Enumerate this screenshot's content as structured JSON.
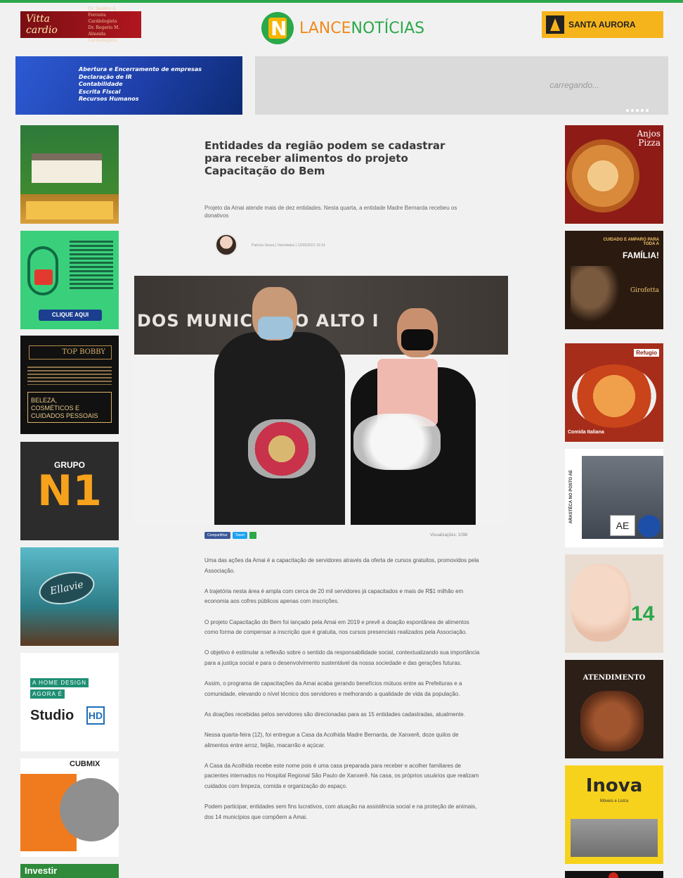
{
  "header": {
    "ad_left_logo": "Vitta cardio",
    "ad_left_doctors": [
      "Dr. Sandro A. Ferreira",
      "Cardiologista",
      "Dr. Rogerio M. Almeida",
      "Cardiologista"
    ],
    "logo_part1": "LANCE",
    "logo_part2": "NOTÍCIAS",
    "ad_right_label": "SANTA AURORA"
  },
  "banner": {
    "left_lines": [
      "Abertura e Encerramento de empresas",
      "Declaração de IR",
      "Contabilidade",
      "Escrita Fiscal",
      "Recursos Humanos"
    ],
    "right_loading": "carregando..."
  },
  "left_ads": {
    "security_cta": "CLIQUE AQUI",
    "beauty_brand": "TOP BOBBY",
    "beauty_lines": [
      "BELEZA,",
      "COSMÉTICOS E",
      "CUIDADOS PESSOAIS"
    ],
    "grupo_label": "GRUPO",
    "grupo_mark": "N1",
    "ellavie": "Ellavie",
    "home_design_1": "A HOME DESIGN",
    "home_design_2": "AGORA É",
    "studio": "Studio",
    "studio_mark": "HD",
    "cubmix": "CUBMIX",
    "investir": "Investir"
  },
  "right_ads": {
    "pizza": "Anjos Pizza",
    "familia_1": "CUIDADO E AMPARO PARA TODA A",
    "familia_2": "FAMÍLIA!",
    "familia_brand": "Girofetta",
    "italian_brand": "Refugio",
    "italian_caption": "Comida Italiana",
    "posto_brand": "AE",
    "posto_side": "ARASTÉCA NO POSTO AE",
    "baby_number": "14",
    "atendimento": "ATENDIMENTO",
    "inova": "Inova",
    "inova_sub": "Móveis e Listra"
  },
  "article": {
    "headline": "Entidades da região podem se cadastrar para receber alimentos do projeto Capacitação do Bem",
    "subtitle": "Projeto da Amai atende mais de dez entidades. Nesta quarta, a entidade Madre Bernarda recebeu os donativos",
    "byline": "Patrícia Souza | Variedades | 12/05/2021 16:14",
    "photo_wall_text": "DOS MUNICÍ   DO ALTO I",
    "share_facebook": "Compartilhar",
    "share_twitter": "Tweet",
    "views": "Visualizações: 1098",
    "paragraphs": [
      "Uma das ações da Amai é a capacitação de servidores através da oferta de cursos gratuitos, promovidos pela Associação.",
      "A trajetória nesta área é ampla com cerca de 20 mil servidores já capacitados e mais de R$1 milhão em economia aos cofres públicos apenas com inscrições.",
      "O projeto Capacitação do Bem foi lançado pela Amai em 2019 e prevê a doação espontânea de alimentos como forma de compensar a inscrição que é gratuita, nos cursos presenciais realizados pela Associação.",
      "O objetivo é estimular a reflexão sobre o sentido da responsabilidade social, contextualizando sua importância para a justiça social e para o desenvolvimento sustentável da nossa sociedade e das gerações futuras.",
      "Assim, o programa de capacitações da Amai acaba gerando benefícios mútuos entre as Prefeituras e a comunidade, elevando o nível técnico dos servidores e melhorando a qualidade de vida da população.",
      "As doações recebidas pelos servidores são direcionadas para as 15 entidades cadastradas, atualmente.",
      "Nessa quarta-feira (12), foi entregue a Casa da Acolhida Madre Bernarda, de Xanxerê, doze quilos de alimentos entre arroz, feijão, macarrão e açúcar.",
      "A Casa da Acolhida recebe este nome pois é uma casa preparada para receber e acolher familiares de pacientes internados no Hospital Regional São Paulo de Xanxerê. Na casa, os próprios usuários que realizam cuidados com limpeza, comida e organização do espaço.",
      "Podem participar, entidades sem fins lucrativos, com atuação na assistência social e na proteção de animais, dos 14 municípios que compõem a Amai."
    ]
  }
}
